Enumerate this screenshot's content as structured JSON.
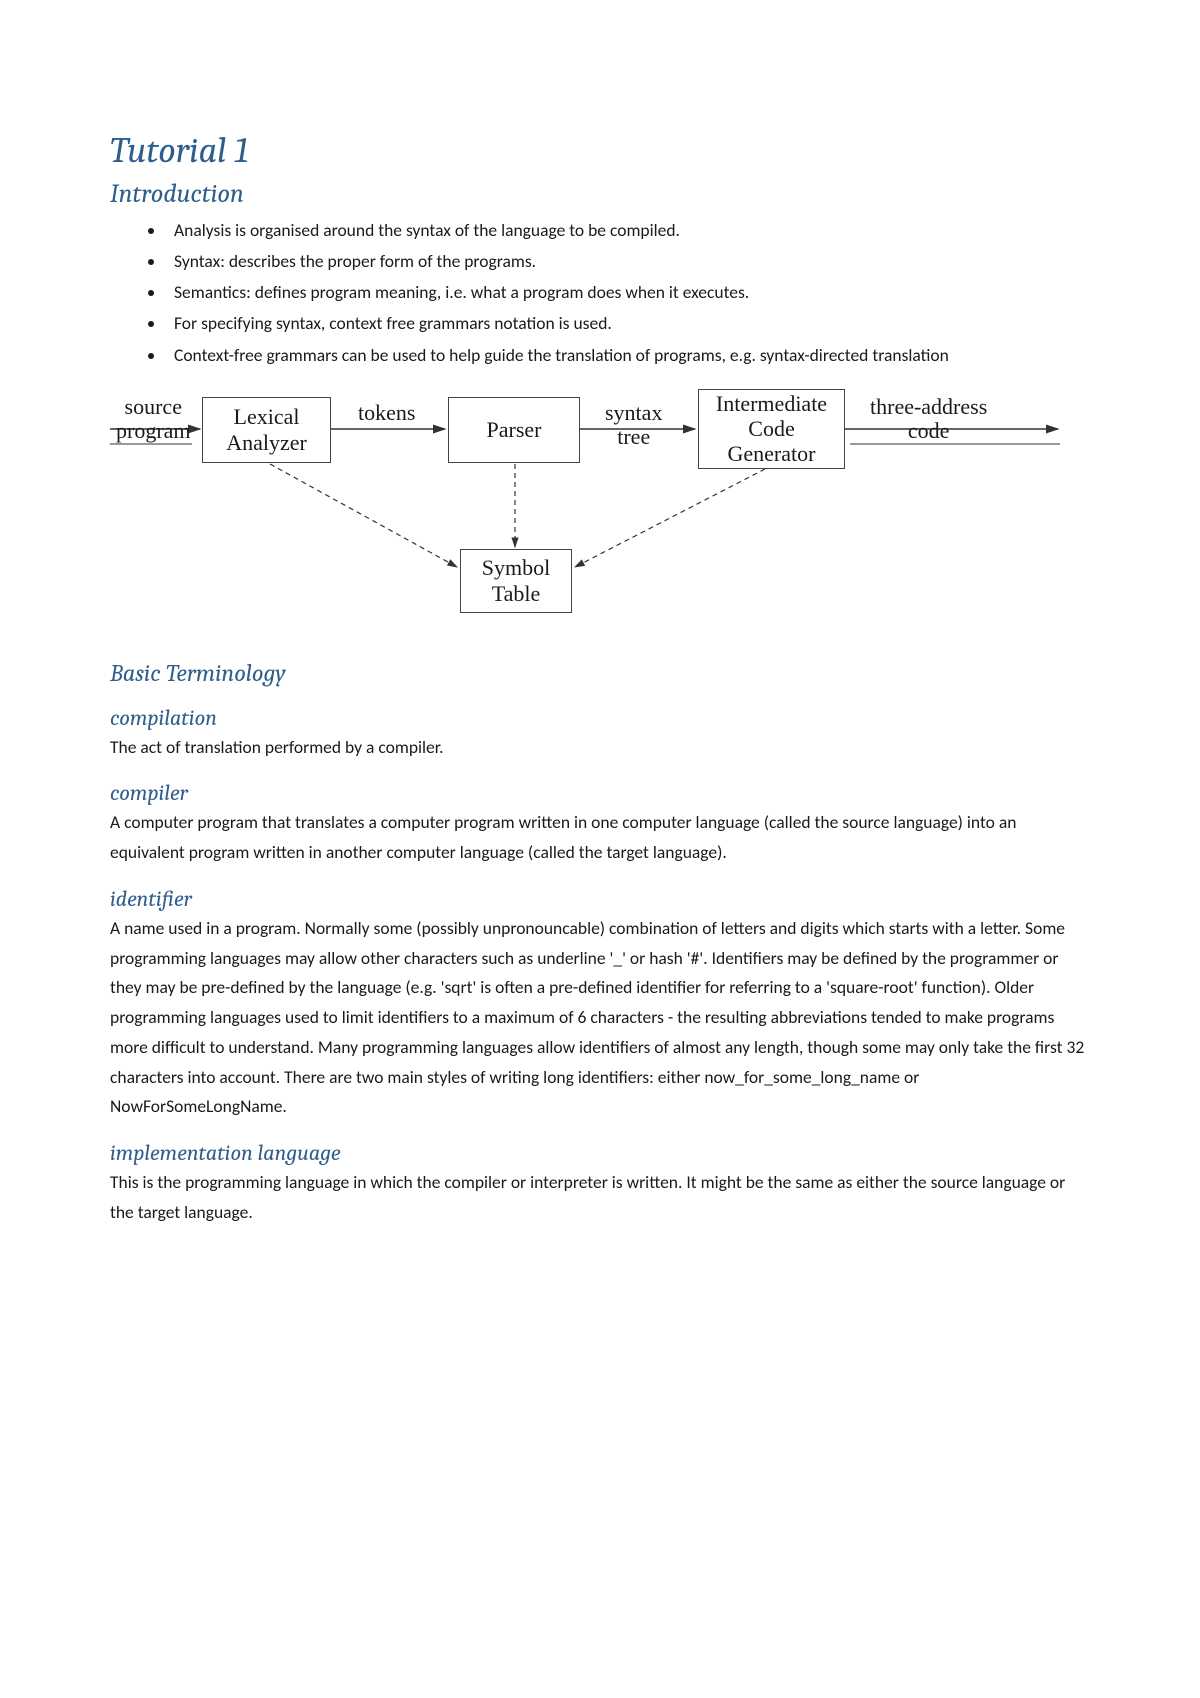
{
  "title": "Tutorial 1",
  "intro": {
    "heading": "Introduction",
    "bullets": [
      "Analysis is organised around the syntax of the language to be compiled.",
      "Syntax: describes the proper form of the programs.",
      "Semantics: defines program meaning, i.e. what a program does when it executes.",
      "For specifying syntax, context free grammars notation is used.",
      "Context-free grammars can be used to help guide the translation of programs, e.g. syntax-directed translation"
    ]
  },
  "diagram": {
    "source_label_l1": "source",
    "source_label_l2": "program",
    "lexical_l1": "Lexical",
    "lexical_l2": "Analyzer",
    "tokens_label": "tokens",
    "parser_label": "Parser",
    "syntax_label_l1": "syntax",
    "syntax_label_l2": "tree",
    "icg_l1": "Intermediate",
    "icg_l2": "Code",
    "icg_l3": "Generator",
    "three_addr_l1": "three-address",
    "three_addr_l2": "code",
    "symbol_l1": "Symbol",
    "symbol_l2": "Table"
  },
  "basic_term": {
    "heading": "Basic Terminology",
    "compilation": {
      "term": "compilation",
      "def": "The act of translation performed by a compiler."
    },
    "compiler": {
      "term": "compiler",
      "def": "A computer program that translates a computer program written in one computer language (called the source language) into an equivalent program written in another computer language (called the target language)."
    },
    "identifier": {
      "term": "identifier",
      "def": "A name used in a program. Normally some (possibly unpronouncable) combination of letters and digits which starts with a letter. Some programming languages may allow other characters such as underline '_' or hash '#'. Identifiers may be defined by the programmer or they may be pre-defined by the language (e.g. 'sqrt' is often a pre-defined identifier for referring to a 'square-root' function). Older programming languages used to limit identifiers to a maximum of 6 characters - the resulting abbreviations tended to make programs more difficult to understand. Many programming languages allow identifiers of almost any length, though some may only take the first 32 characters into account. There are two main styles of writing long identifiers: either now_for_some_long_name or NowForSomeLongName."
    },
    "impl_lang": {
      "term": "implementation language",
      "def": "This is the programming language in which the compiler or interpreter is written. It might be the same as either the source language or the target language."
    }
  }
}
